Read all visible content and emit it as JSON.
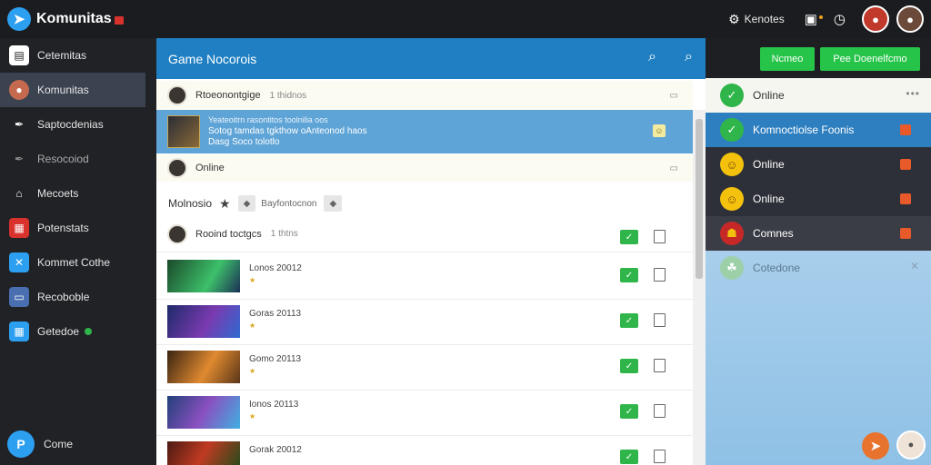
{
  "app": {
    "name": "Komunitas",
    "logo": "paper-plane-logo"
  },
  "topbar": {
    "link_label": "Kenotes",
    "link_icon": "gear-icon",
    "icons": [
      "note-icon",
      "clock-icon"
    ]
  },
  "sidebar": {
    "items": [
      {
        "label": "Cetemitas",
        "icon": "page-icon",
        "color": "#ffffff"
      },
      {
        "label": "Komunitas",
        "icon": "avatar-icon",
        "color": "#c56a4f",
        "active": true
      },
      {
        "label": "Saptocdenias",
        "icon": "pin-icon",
        "color": "#ffffff"
      },
      {
        "label": "Resocoiod",
        "icon": "pin-icon",
        "color": "#8a8a8a"
      },
      {
        "label": "Mecoets",
        "icon": "home-icon",
        "color": "#ffffff"
      },
      {
        "label": "Potenstats",
        "icon": "grid-icon",
        "color": "#d9322c"
      },
      {
        "label": "Kommet Cothe",
        "icon": "cross-icon",
        "color": "#2d9ff0"
      },
      {
        "label": "Recoboble",
        "icon": "window-icon",
        "color": "#4a6fb0"
      },
      {
        "label": "Getedoe",
        "icon": "grid-icon",
        "color": "#2d9ff0",
        "status": true
      }
    ],
    "bottom_label": "Come"
  },
  "main": {
    "title": "Game Nocorois",
    "buttons": [
      "Ncmeo",
      "Pee Doenelfcmo"
    ],
    "rows": [
      {
        "text": "Rtoeonontgige",
        "sub": "1 thidnos"
      },
      {
        "text": "Online"
      }
    ],
    "featured": {
      "line1": "Yeateoitrn rasontitos toolnilia oos",
      "line2": "Sotog tamdas tgkthow oAnteonod haos",
      "line3": "Dasg Soco tolotlo"
    },
    "section": {
      "label": "Molnosio",
      "chip": "Bayfontocnon"
    },
    "user_row": {
      "text": "Rooind toctgcs",
      "sub": "1 thtns"
    },
    "games": [
      {
        "title": "Lonos 20012"
      },
      {
        "title": "Goras 20113"
      },
      {
        "title": "Gomo 20113"
      },
      {
        "title": "Ionos 20113"
      },
      {
        "title": "Gorak 20012"
      }
    ]
  },
  "right_panel": {
    "items": [
      {
        "label": "Online",
        "icon": "check-icon",
        "bg": "transparent",
        "fg": "#333333"
      },
      {
        "label": "Komnoctiolse Foonis",
        "icon": "check-icon",
        "bg": "#2e7fc0",
        "fg": "#ffffff"
      },
      {
        "label": "Online",
        "icon": "emoji-icon",
        "bg": "#2d3038",
        "fg": "#ffffff"
      },
      {
        "label": "Online",
        "icon": "emoji-icon",
        "bg": "#2d3038",
        "fg": "#ffffff"
      },
      {
        "label": "Comnes",
        "icon": "badge-icon",
        "bg": "#3a3d45",
        "fg": "#ffffff"
      },
      {
        "label": "Cotedone",
        "icon": "leaf-icon",
        "bg": "transparent",
        "fg": "#5a7a94"
      }
    ]
  }
}
